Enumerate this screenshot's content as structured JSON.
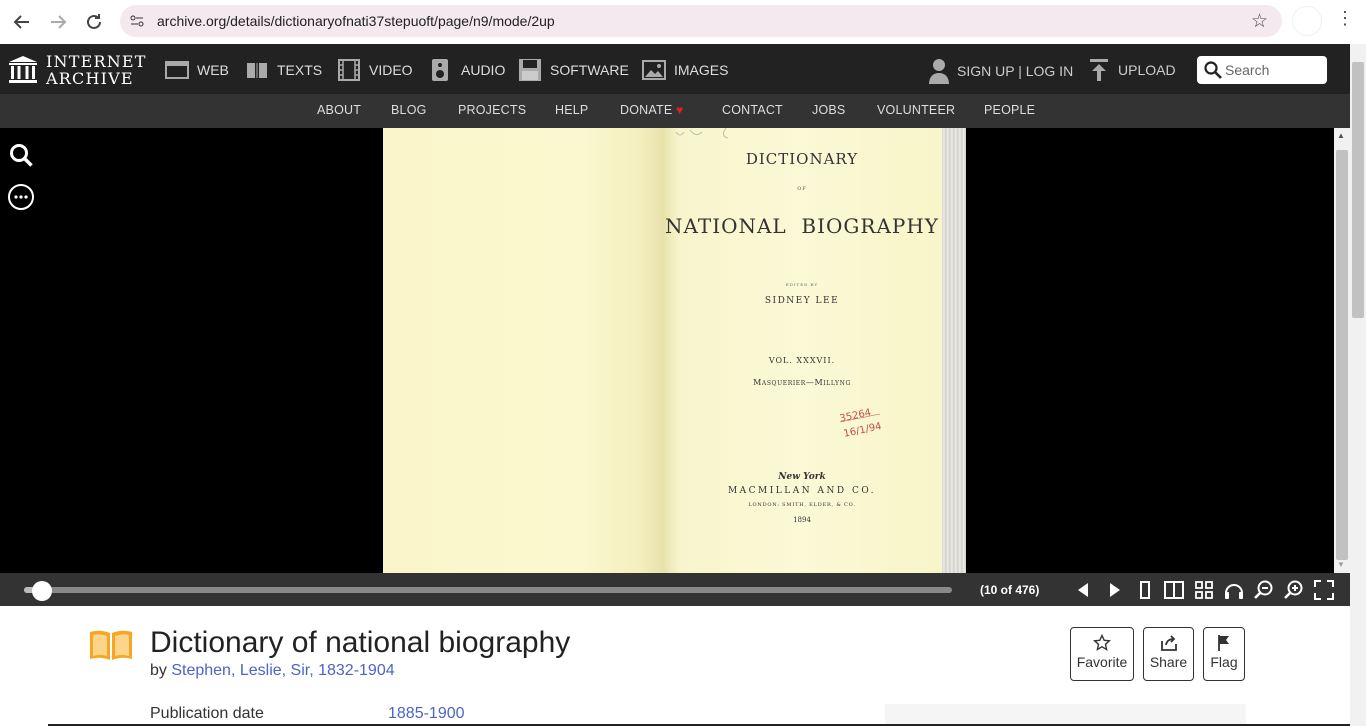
{
  "browser": {
    "url": "archive.org/details/dictionaryofnati37stepuoft/page/n9/mode/2up",
    "back_icon": "back-arrow-icon",
    "forward_icon": "forward-arrow-icon",
    "reload_icon": "reload-icon"
  },
  "ia_nav": {
    "logo_line1": "INTERNET",
    "logo_line2": "ARCHIVE",
    "media": [
      {
        "label": "WEB",
        "icon": "web-icon"
      },
      {
        "label": "TEXTS",
        "icon": "book-icon"
      },
      {
        "label": "VIDEO",
        "icon": "film-icon"
      },
      {
        "label": "AUDIO",
        "icon": "speaker-icon"
      },
      {
        "label": "SOFTWARE",
        "icon": "floppy-icon"
      },
      {
        "label": "IMAGES",
        "icon": "image-icon"
      }
    ],
    "account_label": "SIGN UP | LOG IN",
    "upload_label": "UPLOAD",
    "search_placeholder": "Search"
  },
  "sub_nav": [
    "ABOUT",
    "BLOG",
    "PROJECTS",
    "HELP",
    "DONATE",
    "CONTACT",
    "JOBS",
    "VOLUNTEER",
    "PEOPLE"
  ],
  "book_page": {
    "title_line1": "DICTIONARY",
    "of": "OF",
    "title_line2": "NATIONAL  BIOGRAPHY",
    "edited_by": "EDITED BY",
    "editor": "SIDNEY LEE",
    "volume": "VOL. XXXVII.",
    "range": "Masquerier—Millyng",
    "publisher_city": "New York",
    "publisher": "MACMILLAN AND CO.",
    "london": "LONDON: SMITH, ELDER, & CO.",
    "year": "1894"
  },
  "viewer": {
    "page_count": "(10 of 476)",
    "progress": 0.019
  },
  "item": {
    "title": "Dictionary of national biography",
    "by_prefix": "by ",
    "author": "Stephen, Leslie, Sir, 1832-1904",
    "actions": [
      "Favorite",
      "Share",
      "Flag"
    ],
    "pub_date_label": "Publication date",
    "pub_date_value": "1885-1900"
  }
}
